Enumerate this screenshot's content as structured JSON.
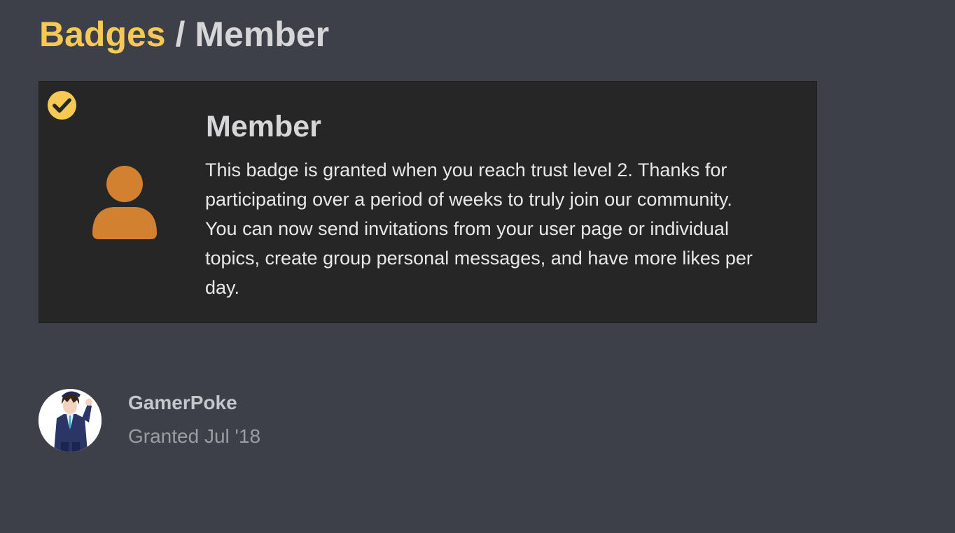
{
  "breadcrumb": {
    "parent": "Badges",
    "separator": " / ",
    "current": "Member"
  },
  "badge": {
    "name": "Member",
    "description": "This badge is granted when you reach trust level 2. Thanks for participating over a period of weeks to truly join our community. You can now send invitations from your user page or individual topics, create group personal messages, and have more likes per day.",
    "icon": "user-icon",
    "granted_indicator": "check-circle-icon",
    "colors": {
      "accent": "#f6c954",
      "badge_icon": "#d1812f",
      "card_background": "#262626",
      "page_background": "#3e4049"
    }
  },
  "grants": [
    {
      "username": "GamerPoke",
      "granted_text": "Granted Jul '18",
      "avatar": "user-avatar"
    }
  ]
}
